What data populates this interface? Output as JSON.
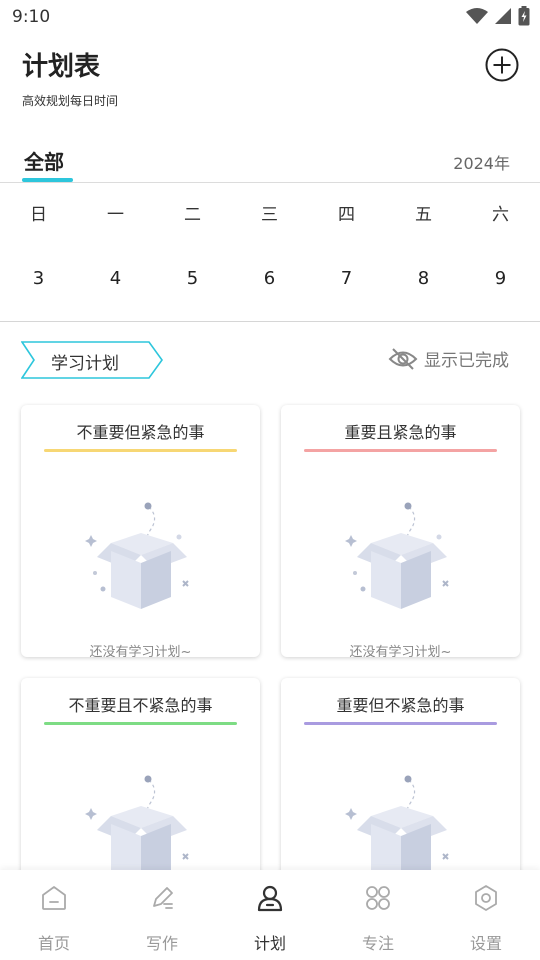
{
  "status_bar": {
    "time": "9:10",
    "icons": [
      "wifi-icon",
      "signal-icon",
      "battery-icon"
    ]
  },
  "header": {
    "title": "计划表",
    "subtitle": "高效规划每日时间",
    "add_icon": "plus-circle-icon"
  },
  "tabs": {
    "active_label": "全部",
    "year_label": "2024年",
    "accent_color": "#2dc6dc"
  },
  "calendar": {
    "weekdays": [
      "日",
      "一",
      "二",
      "三",
      "四",
      "五",
      "六"
    ],
    "dates": [
      "3",
      "4",
      "5",
      "6",
      "7",
      "8",
      "9"
    ]
  },
  "section": {
    "tag_label": "学习计划",
    "show_done_label": "显示已完成",
    "show_done_icon": "eye-off-icon"
  },
  "quadrants": [
    {
      "title": "不重要但紧急的事",
      "color": "#f7d774",
      "empty_text": "还没有学习计划~"
    },
    {
      "title": "重要且紧急的事",
      "color": "#f4a3a3",
      "empty_text": "还没有学习计划~"
    },
    {
      "title": "不重要且不紧急的事",
      "color": "#7ddc84",
      "empty_text": ""
    },
    {
      "title": "重要但不紧急的事",
      "color": "#a99be0",
      "empty_text": ""
    }
  ],
  "bottom_nav": {
    "items": [
      {
        "label": "首页",
        "icon": "home-icon",
        "active": false
      },
      {
        "label": "写作",
        "icon": "pen-icon",
        "active": false
      },
      {
        "label": "计划",
        "icon": "plan-person-icon",
        "active": true
      },
      {
        "label": "专注",
        "icon": "focus-grid-icon",
        "active": false
      },
      {
        "label": "设置",
        "icon": "gear-icon",
        "active": false
      }
    ]
  }
}
